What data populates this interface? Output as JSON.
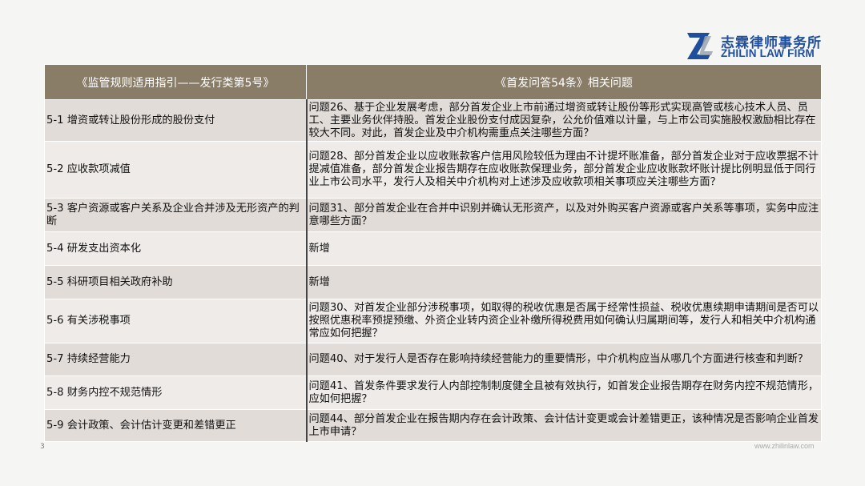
{
  "brand": {
    "name_cn": "志霖律师事务所",
    "name_en": "ZHILIN LAW FIRM",
    "logo_icon": "zl-monogram-icon",
    "color": "#1f4e9c"
  },
  "table": {
    "header_bg": "#8a7d68",
    "headers": [
      "《监管规则适用指引——发行类第5号》",
      "《首发问答54条》相关问题"
    ],
    "rows": [
      {
        "left": "5-1 增资或转让股份形成的股份支付",
        "right": "问题26、基于企业发展考虑，部分首发企业上市前通过增资或转让股份等形式实现高管或核心技术人员、员工、主要业务伙伴持股。首发企业股份支付成因复杂，公允价值难以计量，与上市公司实施股权激励相比存在较大不同。对此，首发企业及中介机构需重点关注哪些方面？"
      },
      {
        "left": "5-2 应收款项减值",
        "right": "问题28、部分首发企业以应收账款客户信用风险较低为理由不计提坏账准备，部分首发企业对于应收票据不计提减值准备，部分首发企业报告期存在应收账款保理业务，部分首发企业应收账款坏账计提比例明显低于同行业上市公司水平，发行人及相关中介机构对上述涉及应收款项相关事项应关注哪些方面？"
      },
      {
        "left": "5-3 客户资源或客户关系及企业合并涉及无形资产的判断",
        "right": "问题31、部分首发企业在合并中识别并确认无形资产，以及对外购买客户资源或客户关系等事项，实务中应注意哪些方面？"
      },
      {
        "left": "5-4 研发支出资本化",
        "right": "新增"
      },
      {
        "left": "5-5 科研项目相关政府补助",
        "right": "新增"
      },
      {
        "left": "5-6 有关涉税事项",
        "right": "问题30、对首发企业部分涉税事项，如取得的税收优惠是否属于经常性损益、税收优惠续期申请期间是否可以按照优惠税率预提预缴、外资企业转内资企业补缴所得税费用如何确认归属期间等，发行人和相关中介机构通常应如何把握？"
      },
      {
        "left": "5-7 持续经营能力",
        "right": "问题40、对于发行人是否存在影响持续经营能力的重要情形，中介机构应当从哪几个方面进行核查和判断？"
      },
      {
        "left": "5-8 财务内控不规范情形",
        "right": "问题41、首发条件要求发行人内部控制制度健全且被有效执行，如首发企业报告期存在财务内控不规范情形，应如何把握？"
      },
      {
        "left": "5-9 会计政策、会计估计变更和差错更正",
        "right": "问题44、部分首发企业在报告期内存在会计政策、会计估计变更或会计差错更正，该种情况是否影响企业首发上市申请？"
      }
    ]
  },
  "footer": {
    "page_number": "3",
    "site": "www.zhilinlaw.com"
  }
}
